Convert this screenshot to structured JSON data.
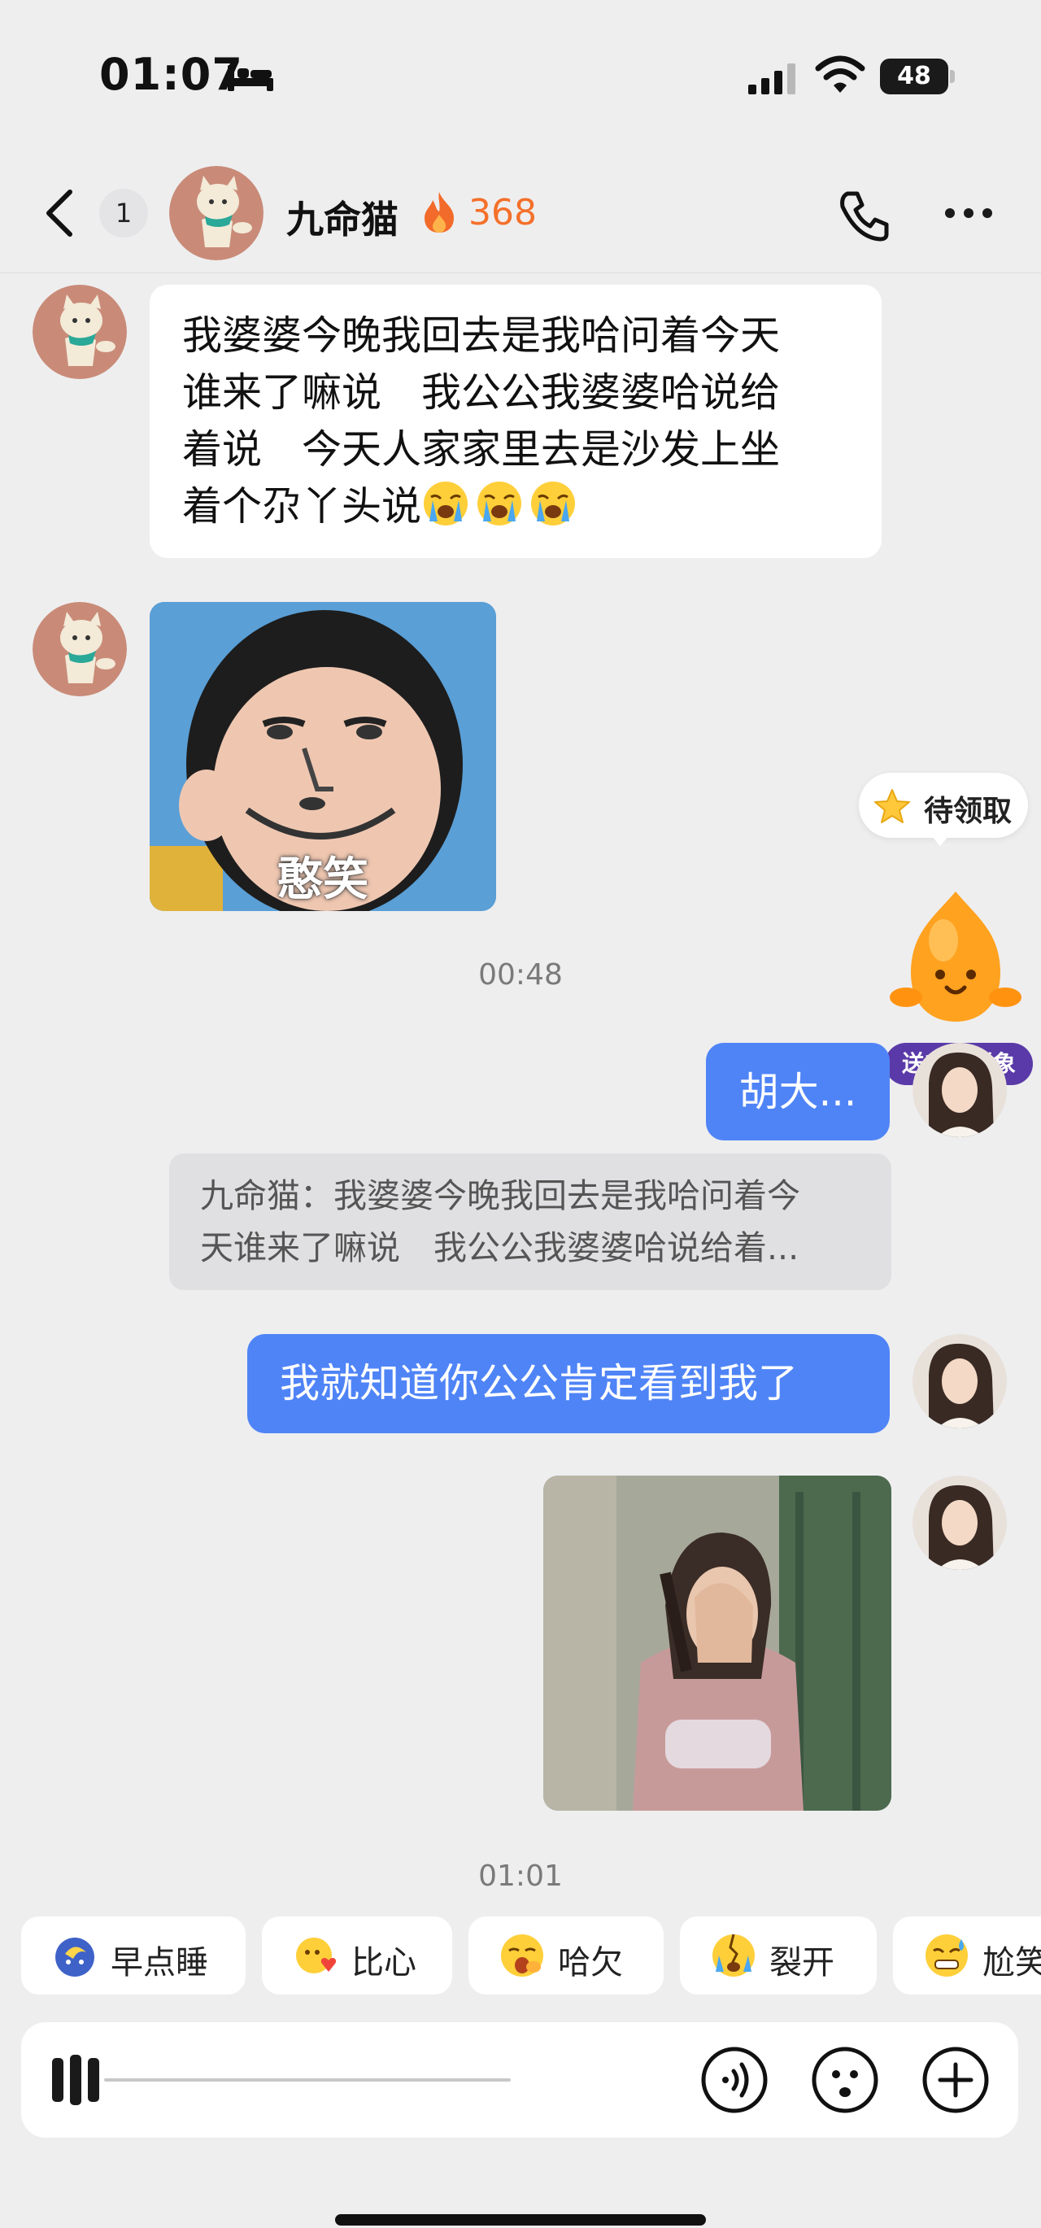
{
  "status_bar": {
    "time": "01:07",
    "battery": "48",
    "icons": [
      "bed-icon",
      "signal-icon",
      "wifi-icon",
      "battery-icon"
    ]
  },
  "header": {
    "unread_count": "1",
    "contact_name": "九命猫",
    "streak": "368",
    "icons": [
      "back-arrow-icon",
      "fire-icon",
      "phone-icon",
      "more-icon"
    ]
  },
  "messages": {
    "m1_lines": [
      "我婆婆今晚我回去是我哈问着今天",
      "谁来了嘛说　我公公我婆婆哈说给",
      "着说　今天人家家里去是沙发上坐",
      "着个尕丫头说"
    ],
    "m1_emoji": "loudly-crying-face",
    "meme_caption": "憨笑",
    "timestamp_1": "00:48",
    "short_reply": "胡大...",
    "quote_line1": "九命猫：我婆婆今晚我回去是我哈问着今",
    "quote_line2": "天谁来了嘛说　我公公我婆婆哈说给着...",
    "long_reply": "我就知道你公公肯定看到我了",
    "timestamp_2": "01:01"
  },
  "pet": {
    "reward_label": "待领取",
    "tag_label": "送毛仔形象"
  },
  "quick_replies": [
    {
      "label": "早点睡",
      "icon": "sleepy-moon-icon"
    },
    {
      "label": "比心",
      "icon": "heart-hands-icon"
    },
    {
      "label": "哈欠",
      "icon": "yawn-icon"
    },
    {
      "label": "裂开",
      "icon": "cracked-face-icon"
    },
    {
      "label": "尬笑",
      "icon": "awkward-smile-icon"
    }
  ],
  "input_bar": {
    "icons": [
      "voice-wave-icon",
      "voice-mode-icon",
      "emoji-icon",
      "plus-icon"
    ]
  },
  "colors": {
    "background": "#eeeeef",
    "outgoing_bubble": "#4f84f7",
    "incoming_bubble": "#ffffff",
    "streak": "#f5702a",
    "pet_tag": "#5a3aa8"
  }
}
